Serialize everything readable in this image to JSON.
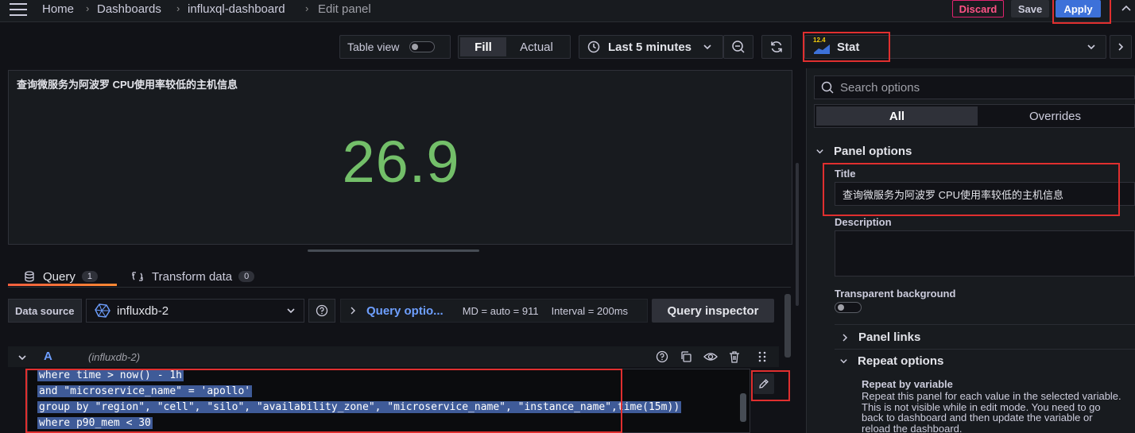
{
  "breadcrumb": {
    "items": [
      "Home",
      "Dashboards",
      "influxql-dashboard",
      "Edit panel"
    ]
  },
  "header": {
    "discard_label": "Discard",
    "save_label": "Save",
    "apply_label": "Apply"
  },
  "toolbar": {
    "table_view_label": "Table view",
    "fill_label": "Fill",
    "actual_label": "Actual",
    "time_range_label": "Last 5 minutes",
    "viz_version_badge": "12.4",
    "viz_name": "Stat"
  },
  "panel": {
    "title": "查询微服务为阿波罗 CPU使用率较低的主机信息",
    "value": "26.9",
    "value_color": "#73bf69"
  },
  "tabs": [
    {
      "label": "Query",
      "count": "1"
    },
    {
      "label": "Transform data",
      "count": "0"
    }
  ],
  "query_bar": {
    "data_source_label": "Data source",
    "data_source_value": "influxdb-2",
    "query_options_label": "Query optio...",
    "md_text": "MD = auto = 911",
    "interval_text": "Interval = 200ms",
    "inspector_label": "Query inspector"
  },
  "query_row": {
    "letter": "A",
    "datasource": "(influxdb-2)",
    "code_lines": [
      "where time > now() - 1h",
      "and \"microservice_name\" = 'apollo'",
      "group by \"region\", \"cell\", \"silo\", \"availability_zone\", \"microservice_name\", \"instance_name\",time(15m))",
      "where p90_mem < 30"
    ]
  },
  "options": {
    "search_placeholder": "Search options",
    "all_label": "All",
    "overrides_label": "Overrides",
    "panel_options_label": "Panel options",
    "title_label": "Title",
    "title_value": "查询微服务为阿波罗 CPU使用率较低的主机信息",
    "description_label": "Description",
    "transparent_label": "Transparent background",
    "panel_links_label": "Panel links",
    "repeat_options_label": "Repeat options",
    "repeat_by_label": "Repeat by variable",
    "repeat_desc": "Repeat this panel for each value in the selected variable. This is not visible while in edit mode. You need to go back to dashboard and then update the variable or reload the dashboard."
  },
  "colors": {
    "accent": "#3d71d9",
    "discard": "#e0226e",
    "highlight": "#e02f2f",
    "link": "#6e9fff"
  }
}
